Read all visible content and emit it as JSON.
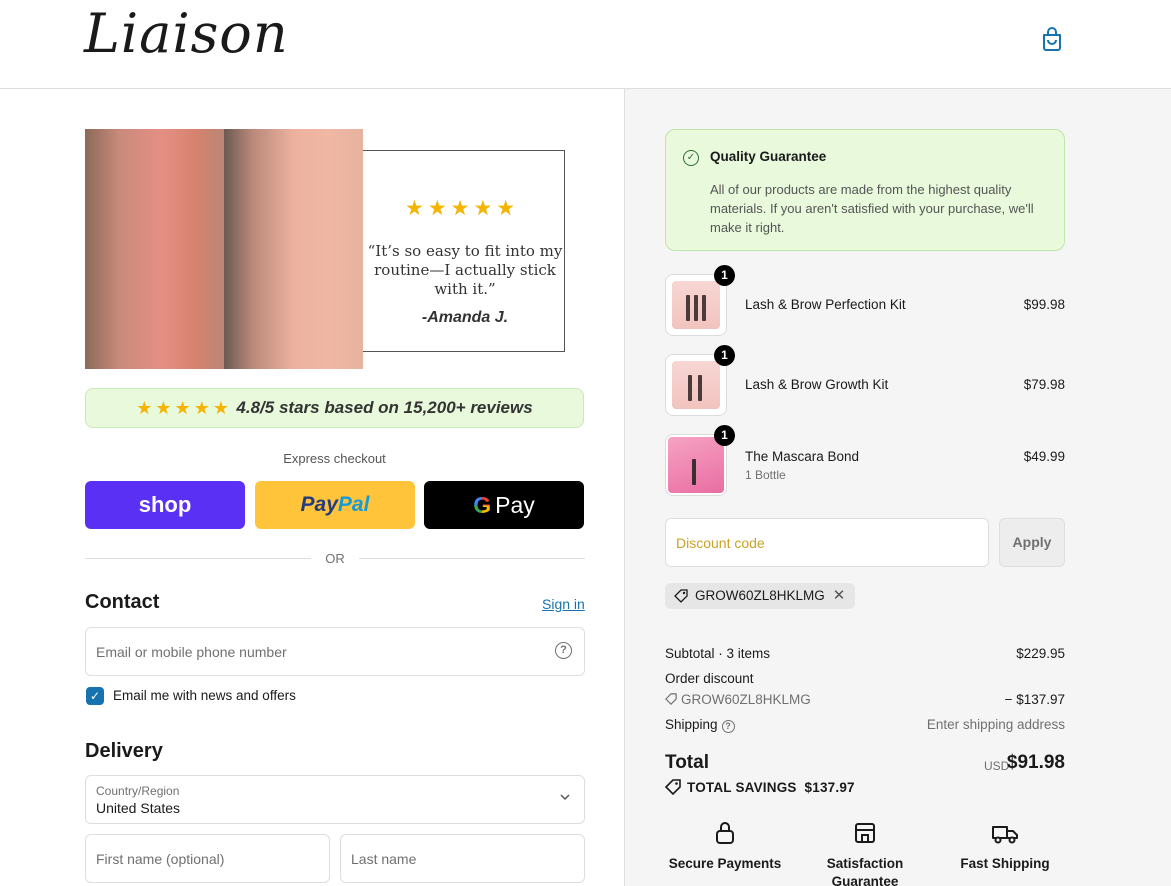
{
  "header": {
    "logo": "Liaison",
    "cart_icon": "shopping-bag-icon"
  },
  "hero": {
    "quote": "“It’s so easy to fit into my routine—I actually stick with it.”",
    "author": "-Amanda J.",
    "stars": "★★★★★"
  },
  "reviews": {
    "stars": "★★★★★",
    "text": "4.8/5 stars based on 15,200+ reviews"
  },
  "express": {
    "label": "Express checkout",
    "shop_label": "shop",
    "paypal_a": "Pay",
    "paypal_b": "Pal",
    "gpay_label": "Pay",
    "or": "OR"
  },
  "contact": {
    "heading": "Contact",
    "sign_in": "Sign in",
    "email_placeholder": "Email or mobile phone number",
    "newsletter_label": "Email me with news and offers",
    "newsletter_checked": true
  },
  "delivery": {
    "heading": "Delivery",
    "country_label": "Country/Region",
    "country_value": "United States",
    "first_name_placeholder": "First name (optional)",
    "last_name_placeholder": "Last name"
  },
  "guarantee": {
    "title": "Quality Guarantee",
    "body": "All of our products are made from the highest quality materials. If you aren't satisfied with your purchase, we'll make it right.",
    "color": "#e8f9dc"
  },
  "cart": {
    "items": [
      {
        "name": "Lash & Brow Perfection Kit",
        "price": "$99.98",
        "qty": "1",
        "variant": ""
      },
      {
        "name": "Lash & Brow Growth Kit",
        "price": "$79.98",
        "qty": "1",
        "variant": ""
      },
      {
        "name": "The Mascara Bond",
        "price": "$49.99",
        "qty": "1",
        "variant": "1 Bottle"
      }
    ]
  },
  "discount": {
    "placeholder": "Discount code",
    "apply": "Apply",
    "applied_code": "GROW60ZL8HKLMG"
  },
  "summary": {
    "subtotal_label": "Subtotal · 3 items",
    "subtotal_value": "$229.95",
    "order_discount_label": "Order discount",
    "discount_code": "GROW60ZL8HKLMG",
    "discount_value": "− $137.97",
    "shipping_label": "Shipping",
    "shipping_value": "Enter shipping address",
    "total_label": "Total",
    "currency": "USD",
    "total_value": "$91.98",
    "savings_label": "TOTAL SAVINGS",
    "savings_value": "$137.97"
  },
  "features": [
    {
      "label": "Secure Payments",
      "icon": "lock-icon"
    },
    {
      "label": "Satisfaction Guarantee",
      "icon": "storefront-icon"
    },
    {
      "label": "Fast Shipping",
      "icon": "truck-icon"
    }
  ],
  "colors": {
    "shop": "#5a31f4",
    "paypal": "#ffc439",
    "gpay": "#000000",
    "link": "#1773b0"
  }
}
